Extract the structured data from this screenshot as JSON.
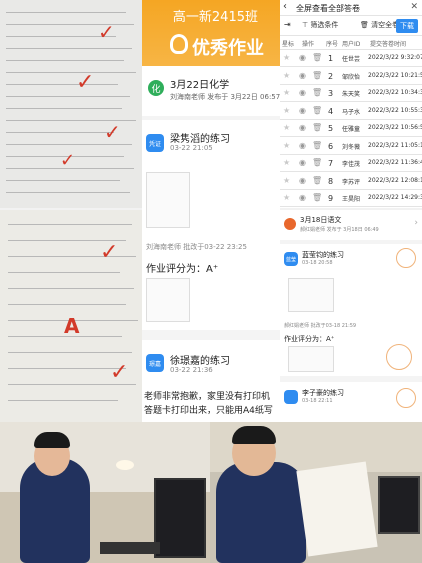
{
  "feed": {
    "class_name": "高一新2415班",
    "logo_text": "优秀作业",
    "post1": {
      "icon_text": "化",
      "title": "3月22日化学",
      "sub": "刘海南老师 发布于 3月22日 06:57"
    },
    "item1": {
      "chip": "凭证",
      "title": "梁隽滔的练习",
      "time": "03-22 21:05"
    },
    "item1_review": "刘海南老师 批改于03-22 23:25",
    "item1_grade": "作业评分为：A⁺",
    "item2": {
      "chip": "璟嘉",
      "title": "徐璟嘉的练习",
      "time": "03-22 21:36"
    },
    "item2_note": "老师非常抱歉，家里没有打印机\n答题卡打印出来，只能用A4纸写"
  },
  "table": {
    "title": "全屏查看全部答卷",
    "filter_label": "筛选条件",
    "clear_label": "清空全卷",
    "download_label": "下载",
    "headers": [
      "星标",
      "操作",
      "序号",
      "用户ID",
      "提交答卷时间"
    ],
    "rows": [
      {
        "no": "1",
        "name": "任世芸",
        "time": "2022/3/22 9:32:07"
      },
      {
        "no": "2",
        "name": "邹欣怡",
        "time": "2022/3/22 10:21:54"
      },
      {
        "no": "3",
        "name": "朱天笑",
        "time": "2022/3/22 10:34:32"
      },
      {
        "no": "4",
        "name": "马子水",
        "time": "2022/3/22 10:55:33"
      },
      {
        "no": "5",
        "name": "任雅童",
        "time": "2022/3/22 10:56:58"
      },
      {
        "no": "6",
        "name": "刘冬薇",
        "time": "2022/3/22 11:05:10"
      },
      {
        "no": "7",
        "name": "李佳茂",
        "time": "2022/3/22 11:36:47"
      },
      {
        "no": "8",
        "name": "李苏评",
        "time": "2022/3/22 12:08:14"
      },
      {
        "no": "9",
        "name": "王昊阳",
        "time": "2022/3/22 14:29:32"
      }
    ]
  },
  "card2": {
    "post_title": "3月18日语文",
    "post_sub": "郝红娟老师 发布于 3月18日 06:49",
    "item1_chip": "蓝莹",
    "item1_title": "蓝莹钧的练习",
    "item1_time": "03-18 20:58",
    "review": "郝红娟老师 批改于03-18 21:59",
    "grade": "作业评分为：A⁺",
    "item2_title": "李子豪的练习",
    "item2_time": "03-18 22:11"
  },
  "colors": {
    "orange": "#f5a623",
    "blue": "#2f8cf0",
    "green": "#2fae5b",
    "red": "#d23a2a"
  }
}
